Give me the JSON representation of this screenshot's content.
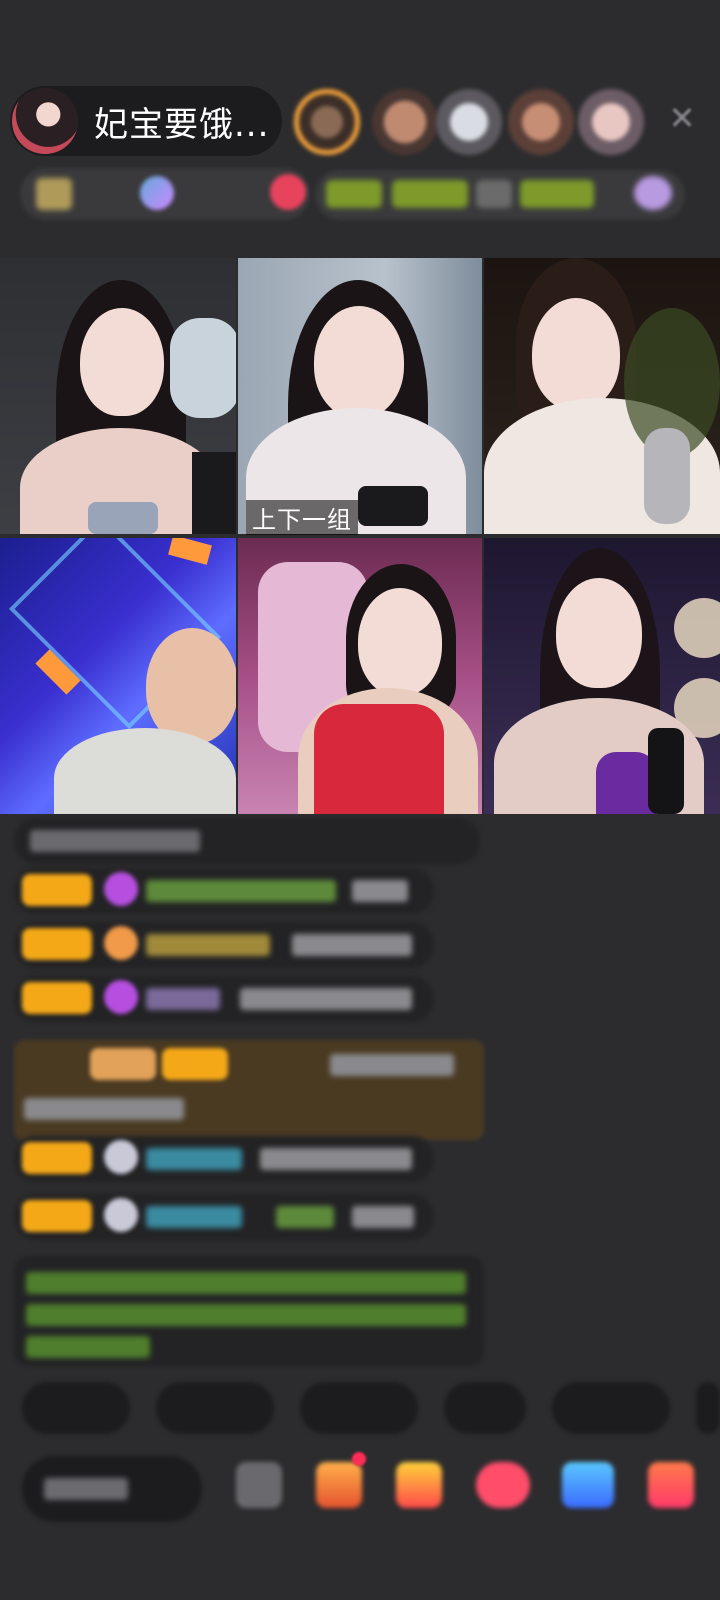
{
  "host": {
    "name": "妃宝要饿..."
  },
  "viewers": [
    "viewer-1",
    "viewer-2",
    "viewer-3",
    "viewer-4",
    "viewer-5"
  ],
  "grid": {
    "overlay_label": "上下一组"
  },
  "icons": {
    "close": "close-icon"
  },
  "colors": {
    "accent": "#f4a818",
    "highlight": "#4a3a22",
    "background": "#2c2c2e"
  }
}
